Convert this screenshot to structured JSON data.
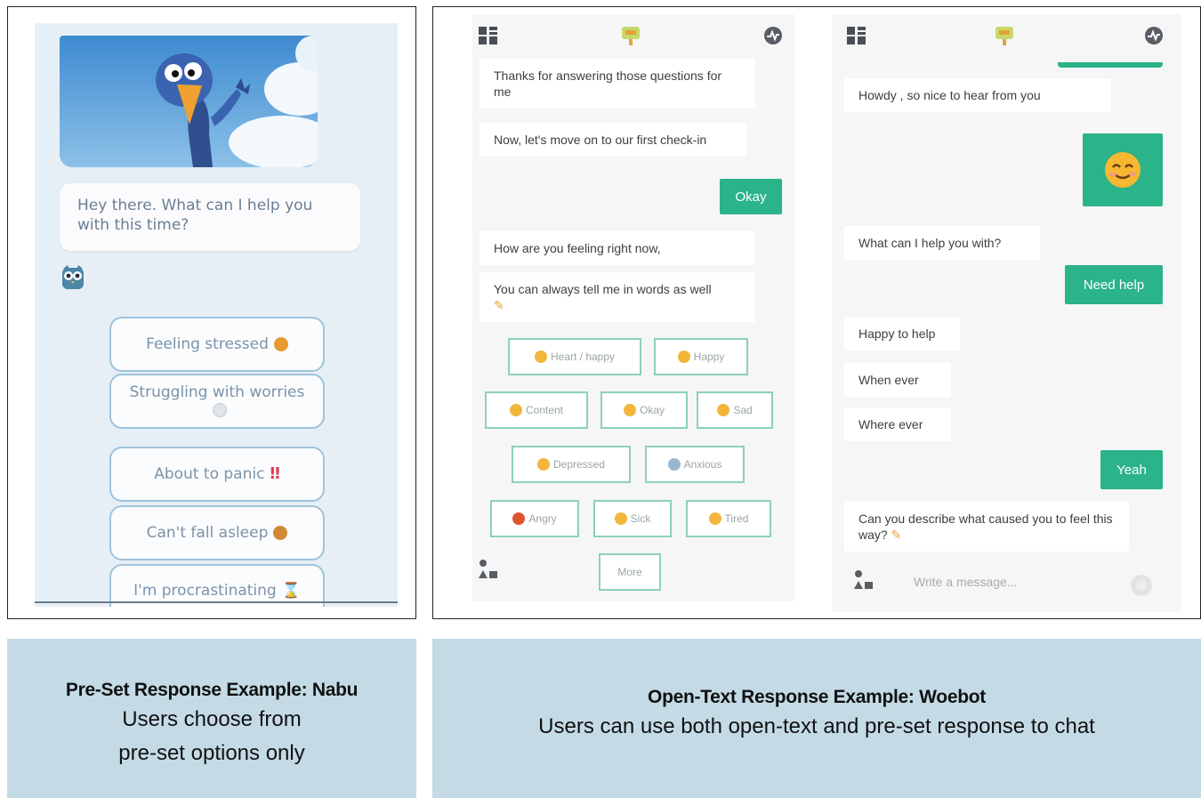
{
  "nabu": {
    "prompt": "Hey there. What can I help you with this time?",
    "options": [
      {
        "label": "Feeling stressed",
        "emoji_color": "#e99a2f"
      },
      {
        "label": "Struggling with worries",
        "emoji_color": "#cfd8df"
      },
      {
        "label": "About to panic",
        "emoji_color": "#e0384b"
      },
      {
        "label": "Can't fall asleep",
        "emoji_color": "#d08a34"
      },
      {
        "label": "I'm procrastinating",
        "emoji_color": "#b99a66"
      }
    ]
  },
  "woebot_left": {
    "messages": [
      "Thanks for answering those questions for me",
      "Now, let's move on to our first check-in",
      "How are you feeling right now,",
      "You can always tell me in words as well"
    ],
    "reply": "Okay",
    "moods": [
      "Heart / happy",
      "Happy",
      "Content",
      "Okay",
      "Sad",
      "Depressed",
      "Anxious",
      "Angry",
      "Sick",
      "Tired"
    ],
    "more": "More"
  },
  "woebot_right": {
    "messages_bot": [
      "Howdy , so nice to hear from you",
      "What can I help you with?",
      "Happy to help",
      "When ever",
      "Where ever",
      "Can you describe what caused you to feel this way?"
    ],
    "replies": [
      "Need help",
      "Yeah"
    ],
    "input_placeholder": "Write a message..."
  },
  "captions": {
    "left_title": "Pre-Set Response Example: Nabu",
    "left_line1": "Users choose from",
    "left_line2": "pre-set options only",
    "right_title": "Open-Text Response Example: Woebot",
    "right_line1": "Users can use both open-text and pre-set response to chat"
  },
  "colors": {
    "caption_bg": "#c4dbe6",
    "woebot_green": "#2bb38a",
    "nabu_border": "#9ec3dc"
  }
}
